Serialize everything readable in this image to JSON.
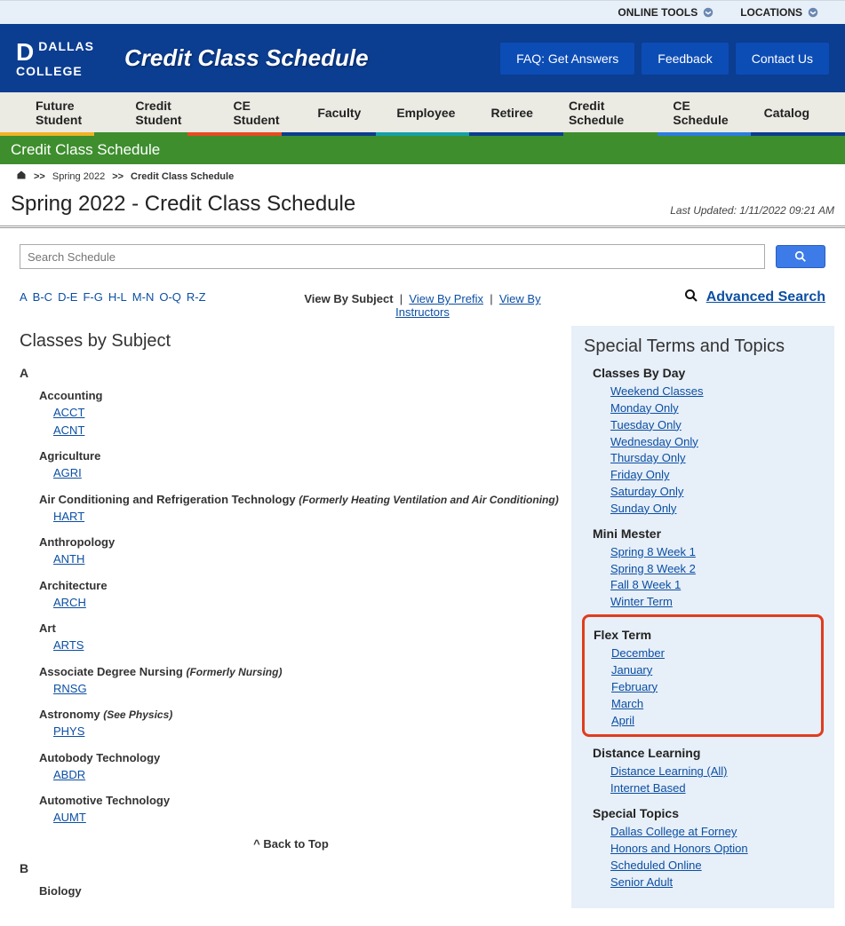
{
  "util": {
    "online": "ONLINE TOOLS",
    "locations": "LOCATIONS"
  },
  "header": {
    "logo": {
      "line1": "DALLAS",
      "line2": "COLLEGE"
    },
    "site_title": "Credit Class Schedule",
    "btn_faq": "FAQ: Get Answers",
    "btn_feedback": "Feedback",
    "btn_contact": "Contact Us"
  },
  "nav": {
    "items": [
      "Future Student",
      "Credit Student",
      "CE Student",
      "Faculty",
      "Employee",
      "Retiree",
      "Credit Schedule",
      "CE Schedule",
      "Catalog"
    ],
    "stripe_colors": [
      "#f0b323",
      "#3e8e2e",
      "#e84a1f",
      "#0b3d91",
      "#15a0a8",
      "#0b3d91",
      "#3e8e2e",
      "#2b7de0",
      "#0b3d91"
    ]
  },
  "greenbar": "Credit Class Schedule",
  "crumb": {
    "home": "⌂",
    "term": "Spring 2022",
    "current": "Credit Class Schedule"
  },
  "title": {
    "h1": "Spring 2022 - Credit Class Schedule",
    "updated": "Last Updated: 1/11/2022 09:21 AM"
  },
  "search": {
    "placeholder": "Search Schedule"
  },
  "alpha": [
    "A",
    "B-C",
    "D-E",
    "F-G",
    "H-L",
    "M-N",
    "O-Q",
    "R-Z"
  ],
  "viewby": {
    "label": "View By Subject",
    "prefix": "View By Prefix",
    "instructors": "View By Instructors",
    "sep": "|"
  },
  "adv": "Advanced Search",
  "sec_title": "Classes by Subject",
  "letters": {
    "A": [
      {
        "name": "Accounting",
        "codes": [
          "ACCT",
          "ACNT"
        ]
      },
      {
        "name": "Agriculture",
        "codes": [
          "AGRI"
        ]
      },
      {
        "name": "Air Conditioning and Refrigeration Technology",
        "note": "(Formerly Heating Ventilation and Air Conditioning)",
        "codes": [
          "HART"
        ]
      },
      {
        "name": "Anthropology",
        "codes": [
          "ANTH"
        ]
      },
      {
        "name": "Architecture",
        "codes": [
          "ARCH"
        ]
      },
      {
        "name": "Art",
        "codes": [
          "ARTS"
        ]
      },
      {
        "name": "Associate Degree Nursing",
        "note": "(Formerly Nursing)",
        "codes": [
          "RNSG"
        ]
      },
      {
        "name": "Astronomy",
        "note": "(See Physics)",
        "codes": [
          "PHYS"
        ]
      },
      {
        "name": "Autobody Technology",
        "codes": [
          "ABDR"
        ]
      },
      {
        "name": "Automotive Technology",
        "codes": [
          "AUMT"
        ]
      }
    ],
    "B": [
      {
        "name": "Biology",
        "codes": []
      }
    ]
  },
  "backtop": "^ Back to Top",
  "side": {
    "title": "Special Terms and Topics",
    "groups": [
      {
        "h": "Classes By Day",
        "items": [
          "Weekend Classes",
          "Monday Only",
          "Tuesday Only",
          "Wednesday Only",
          "Thursday Only",
          "Friday Only",
          "Saturday Only",
          "Sunday Only"
        ]
      },
      {
        "h": "Mini Mester",
        "items": [
          "Spring 8 Week 1",
          "Spring 8 Week 2",
          "Fall 8 Week 1",
          "Winter Term"
        ]
      },
      {
        "h": "Flex Term",
        "items": [
          "December",
          "January",
          "February",
          "March",
          "April"
        ],
        "highlight": true
      },
      {
        "h": "Distance Learning",
        "items": [
          "Distance Learning (All)",
          "Internet Based"
        ]
      },
      {
        "h": "Special Topics",
        "items": [
          "Dallas College at Forney",
          "Honors and Honors Option",
          "Scheduled Online",
          "Senior Adult"
        ]
      }
    ]
  }
}
